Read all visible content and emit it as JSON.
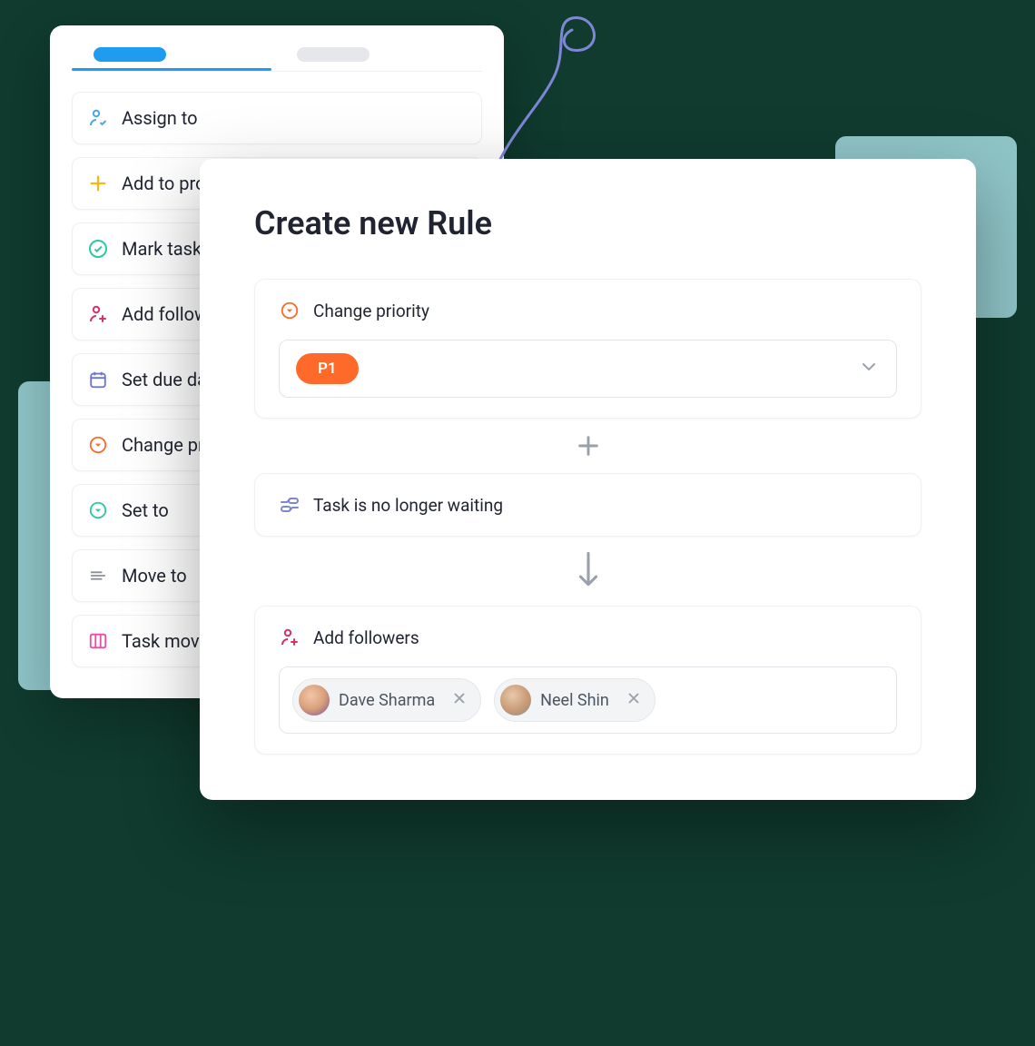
{
  "actions": [
    {
      "label": "Assign to"
    },
    {
      "label": "Add to project"
    },
    {
      "label": "Mark task"
    },
    {
      "label": "Add followers"
    },
    {
      "label": "Set due date"
    },
    {
      "label": "Change priority"
    },
    {
      "label": "Set to"
    },
    {
      "label": "Move to"
    },
    {
      "label": "Task moved"
    }
  ],
  "modal": {
    "title": "Create new Rule",
    "change_priority": {
      "label": "Change priority",
      "value": "P1"
    },
    "waiting": {
      "label": "Task is no longer waiting"
    },
    "followers": {
      "label": "Add followers",
      "chips": [
        {
          "name": "Dave Sharma"
        },
        {
          "name": "Neel Shin"
        }
      ]
    }
  }
}
